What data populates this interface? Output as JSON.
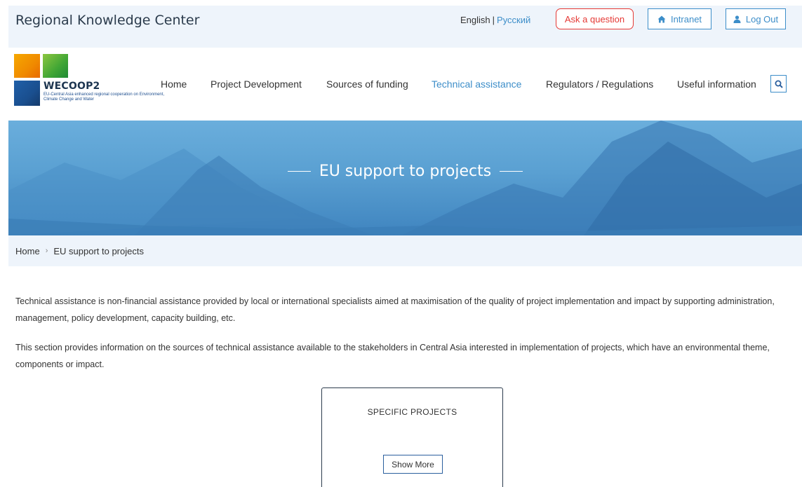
{
  "header": {
    "site_title": "Regional Knowledge Center",
    "lang_english": "English",
    "lang_separator": "|",
    "lang_russian": "Русский",
    "ask_question": "Ask a question",
    "intranet": "Intranet",
    "logout": "Log Out",
    "icons": {
      "intranet": "home-icon",
      "logout": "user-icon"
    }
  },
  "logo": {
    "name": "WECOOP2",
    "subtitle": "EU-Central Asia enhanced regional cooperation on Environment, Climate Change and Water"
  },
  "nav": {
    "items": [
      {
        "label": "Home"
      },
      {
        "label": "Project Development"
      },
      {
        "label": "Sources of funding"
      },
      {
        "label": "Technical assistance"
      },
      {
        "label": "Regulators / Regulations"
      },
      {
        "label": "Useful information"
      }
    ],
    "active_index": 3,
    "search_icon": "search-icon"
  },
  "hero": {
    "title": "EU support to projects"
  },
  "breadcrumb": {
    "home": "Home",
    "current": "EU support to projects"
  },
  "content": {
    "paragraph1": "Technical assistance is non-financial assistance provided by local or international specialists aimed at maximisation of the quality of project implementation and impact by supporting administration, management, policy development, capacity building, etc.",
    "paragraph2": "This section provides information on the sources of technical assistance available to the stakeholders in Central Asia interested in implementation of projects, which have an environmental theme, components or impact."
  },
  "card": {
    "title": "SPECIFIC PROJECTS",
    "button": "Show More"
  },
  "colors": {
    "accent": "#3d8ec9",
    "alert": "#e53935",
    "light_bg": "#eef4fb",
    "hero_blue": "#5aa0d2"
  }
}
